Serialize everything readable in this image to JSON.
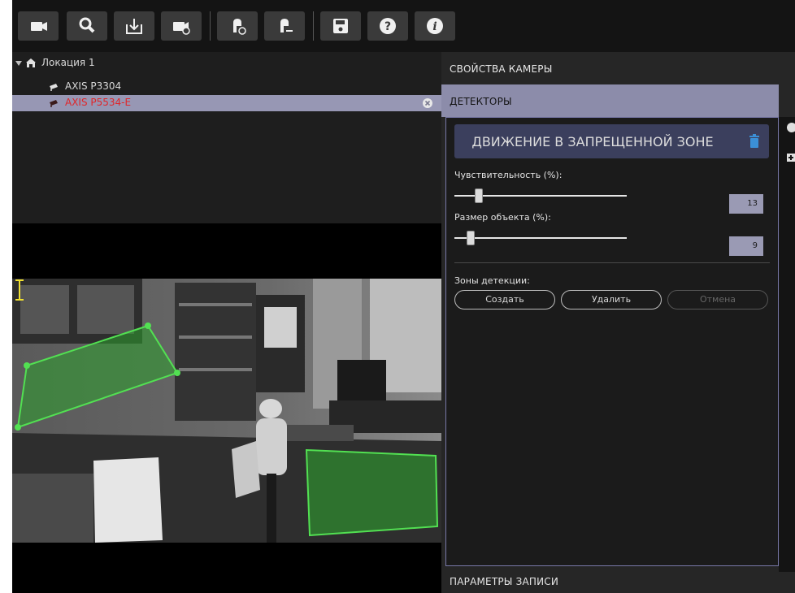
{
  "toolbar": {
    "buttons": [
      {
        "icon": "camera-add-icon"
      },
      {
        "icon": "search-icon"
      },
      {
        "icon": "download-icon"
      },
      {
        "icon": "camera-settings-icon"
      },
      {
        "icon": "user-add-icon"
      },
      {
        "icon": "user-remove-icon"
      },
      {
        "icon": "save-icon"
      },
      {
        "icon": "help-icon"
      },
      {
        "icon": "info-icon"
      }
    ]
  },
  "tree": {
    "location": "Локация 1",
    "cameras": [
      {
        "name": "AXIS P3304",
        "selected": false
      },
      {
        "name": "AXIS P5534-E",
        "selected": true
      }
    ]
  },
  "panel": {
    "camera_properties": "СВОЙСТВА КАМЕРЫ",
    "detectors": "ДЕТЕКТОРЫ",
    "recording_params": "ПАРАМЕТРЫ ЗАПИСИ"
  },
  "detector": {
    "title": "ДВИЖЕНИЕ В ЗАПРЕЩЕННОЙ ЗОНЕ",
    "sensitivity_label": "Чувствительность (%):",
    "sensitivity_value": "13",
    "object_size_label": "Размер объекта (%):",
    "object_size_value": "9",
    "zones_label": "Зоны детекции:",
    "create_label": "Создать",
    "delete_label": "Удалить",
    "cancel_label": "Отмена"
  },
  "colors": {
    "selection": "#9797b4",
    "selected_text": "#e0262a",
    "zone_fill": "#2ea02e",
    "zone_stroke": "#52e052",
    "accent_header": "#3b3f5d",
    "delete_icon": "#3b8fd6"
  }
}
